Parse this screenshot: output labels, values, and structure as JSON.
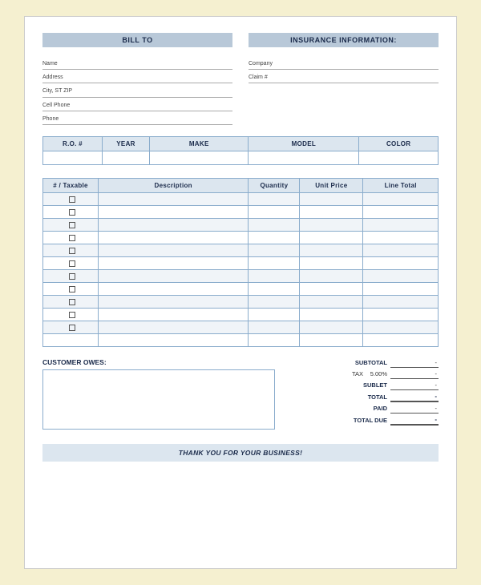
{
  "header": {
    "bill_to_label": "BILL TO",
    "insurance_label": "INSURANCE INFORMATION:"
  },
  "bill_to_fields": [
    {
      "label": "Name",
      "value": ""
    },
    {
      "label": "Address",
      "value": ""
    },
    {
      "label": "City, ST ZIP",
      "value": ""
    },
    {
      "label": "Cell Phone",
      "value": ""
    },
    {
      "label": "Phone",
      "value": ""
    }
  ],
  "insurance_fields": [
    {
      "label": "Company",
      "value": ""
    },
    {
      "label": "Claim #",
      "value": ""
    }
  ],
  "vehicle_table": {
    "headers": [
      "R.O. #",
      "YEAR",
      "MAKE",
      "MODEL",
      "COLOR"
    ],
    "row": [
      "",
      "",
      "",
      "",
      ""
    ]
  },
  "items_table": {
    "headers": [
      "# / Taxable",
      "Description",
      "Quantity",
      "Unit Price",
      "Line Total"
    ],
    "rows": [
      {
        "num": "",
        "taxable": true,
        "desc": "",
        "qty": "",
        "price": "",
        "total": ""
      },
      {
        "num": "",
        "taxable": true,
        "desc": "",
        "qty": "",
        "price": "",
        "total": ""
      },
      {
        "num": "",
        "taxable": true,
        "desc": "",
        "qty": "",
        "price": "",
        "total": ""
      },
      {
        "num": "",
        "taxable": true,
        "desc": "",
        "qty": "",
        "price": "",
        "total": ""
      },
      {
        "num": "",
        "taxable": true,
        "desc": "",
        "qty": "",
        "price": "",
        "total": ""
      },
      {
        "num": "",
        "taxable": true,
        "desc": "",
        "qty": "",
        "price": "",
        "total": ""
      },
      {
        "num": "",
        "taxable": true,
        "desc": "",
        "qty": "",
        "price": "",
        "total": ""
      },
      {
        "num": "",
        "taxable": true,
        "desc": "",
        "qty": "",
        "price": "",
        "total": ""
      },
      {
        "num": "",
        "taxable": true,
        "desc": "",
        "qty": "",
        "price": "",
        "total": ""
      },
      {
        "num": "",
        "taxable": true,
        "desc": "",
        "qty": "",
        "price": "",
        "total": ""
      },
      {
        "num": "",
        "taxable": true,
        "desc": "",
        "qty": "",
        "price": "",
        "total": ""
      },
      {
        "num": "",
        "taxable": false,
        "desc": "",
        "qty": "",
        "price": "",
        "total": ""
      }
    ]
  },
  "totals": {
    "subtotal_label": "SUBTOTAL",
    "subtotal_value": "-",
    "tax_label": "TAX",
    "tax_rate": "5.00%",
    "tax_value": "-",
    "sublet_label": "SUBLET",
    "sublet_value": "-",
    "total_label": "TOTAL",
    "total_value": "-",
    "paid_label": "PAID",
    "paid_value": "-",
    "total_due_label": "TOTAL DUE",
    "total_due_value": "-"
  },
  "customer_owes": {
    "label": "CUSTOMER OWES:"
  },
  "footer": {
    "text": "THANK YOU FOR YOUR BUSINESS!"
  }
}
